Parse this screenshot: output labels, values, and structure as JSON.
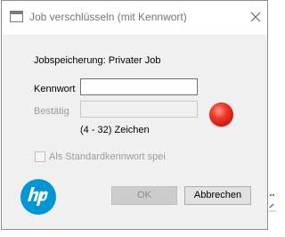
{
  "window": {
    "title": "Job verschlüsseln (mit Kennwort)"
  },
  "job_storage": {
    "label": "Jobspeicherung: Privater Job"
  },
  "password": {
    "label": "Kennwort",
    "value": ""
  },
  "confirm": {
    "label": "Bestätig",
    "value": ""
  },
  "length_hint": "(4 - 32) Zeichen",
  "default_password_checkbox": {
    "label": "Als Standardkennwort spei",
    "checked": false
  },
  "status_indicator": {
    "color": "#e0281a"
  },
  "buttons": {
    "ok_label": "OK",
    "cancel_label": "Abbrechen"
  },
  "brand": {
    "logo_text": "hp",
    "color": "#0096d6"
  }
}
